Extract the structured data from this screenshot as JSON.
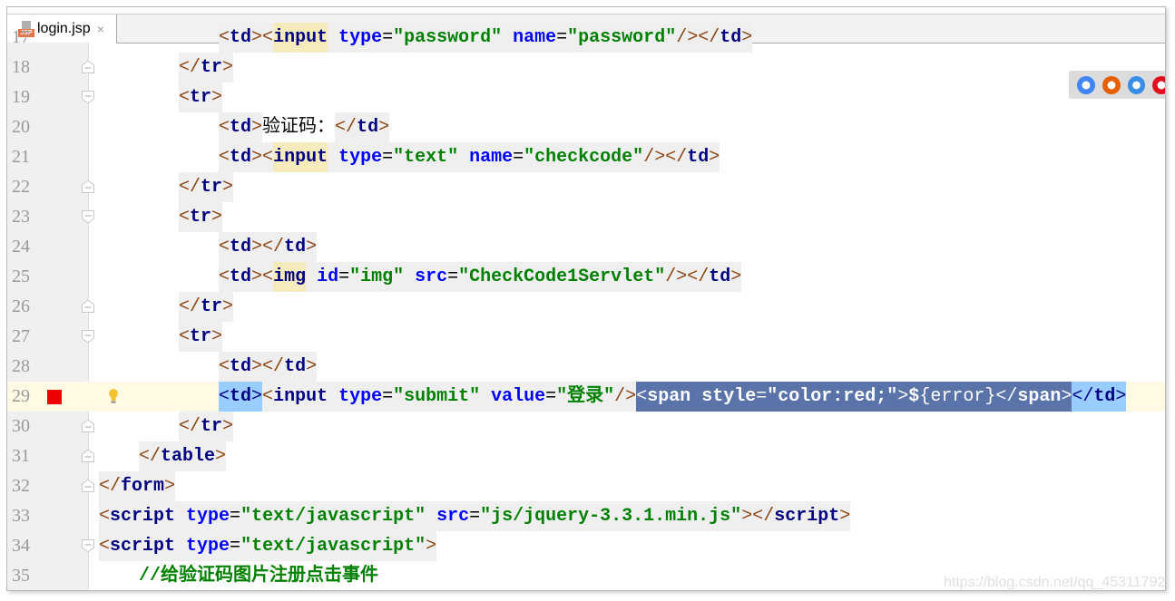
{
  "tab": {
    "file_name": "login.jsp",
    "icon_label": "JSP",
    "close": "×"
  },
  "browsers": [
    {
      "name": "chrome-icon",
      "color": "#4285f4"
    },
    {
      "name": "firefox-icon",
      "color": "#e66000"
    },
    {
      "name": "safari-icon",
      "color": "#3a8ee6"
    },
    {
      "name": "opera-icon",
      "color": "#e0101f"
    }
  ],
  "watermark": "https://blog.csdn.net/qq_45311792",
  "lines": [
    {
      "n": "17",
      "indent": 3,
      "fold": "",
      "tokens": [
        [
          "br",
          "<"
        ],
        [
          "tg",
          "td"
        ],
        [
          "br",
          ">"
        ],
        [
          "br",
          "<"
        ],
        [
          "tgh",
          "input"
        ],
        [
          "at",
          " type"
        ],
        [
          "eq",
          "="
        ],
        [
          "vl",
          "\"password\""
        ],
        [
          "at",
          " name"
        ],
        [
          "eq",
          "="
        ],
        [
          "vl",
          "\"password\""
        ],
        [
          "br",
          "/>"
        ],
        [
          "br",
          "</"
        ],
        [
          "tg",
          "td"
        ],
        [
          "br",
          ">"
        ]
      ]
    },
    {
      "n": "18",
      "indent": 2,
      "fold": "end",
      "tokens": [
        [
          "br",
          "</"
        ],
        [
          "tg",
          "tr"
        ],
        [
          "br",
          ">"
        ]
      ]
    },
    {
      "n": "19",
      "indent": 2,
      "fold": "start",
      "tokens": [
        [
          "br",
          "<"
        ],
        [
          "tg",
          "tr"
        ],
        [
          "br",
          ">"
        ]
      ]
    },
    {
      "n": "20",
      "indent": 3,
      "fold": "",
      "tokens": [
        [
          "br",
          "<"
        ],
        [
          "tg",
          "td"
        ],
        [
          "br",
          ">"
        ],
        [
          "tx",
          "验证码："
        ],
        [
          "br",
          "</"
        ],
        [
          "tg",
          "td"
        ],
        [
          "br",
          ">"
        ]
      ]
    },
    {
      "n": "21",
      "indent": 3,
      "fold": "",
      "tokens": [
        [
          "br",
          "<"
        ],
        [
          "tg",
          "td"
        ],
        [
          "br",
          ">"
        ],
        [
          "br",
          "<"
        ],
        [
          "tgh",
          "input"
        ],
        [
          "at",
          " type"
        ],
        [
          "eq",
          "="
        ],
        [
          "vl",
          "\"text\""
        ],
        [
          "at",
          " name"
        ],
        [
          "eq",
          "="
        ],
        [
          "vl",
          "\"checkcode\""
        ],
        [
          "br",
          "/>"
        ],
        [
          "br",
          "</"
        ],
        [
          "tg",
          "td"
        ],
        [
          "br",
          ">"
        ]
      ]
    },
    {
      "n": "22",
      "indent": 2,
      "fold": "end",
      "tokens": [
        [
          "br",
          "</"
        ],
        [
          "tg",
          "tr"
        ],
        [
          "br",
          ">"
        ]
      ]
    },
    {
      "n": "23",
      "indent": 2,
      "fold": "start",
      "tokens": [
        [
          "br",
          "<"
        ],
        [
          "tg",
          "tr"
        ],
        [
          "br",
          ">"
        ]
      ]
    },
    {
      "n": "24",
      "indent": 3,
      "fold": "",
      "tokens": [
        [
          "br",
          "<"
        ],
        [
          "tg",
          "td"
        ],
        [
          "br",
          ">"
        ],
        [
          "br",
          "</"
        ],
        [
          "tg",
          "td"
        ],
        [
          "br",
          ">"
        ]
      ]
    },
    {
      "n": "25",
      "indent": 3,
      "fold": "",
      "tokens": [
        [
          "br",
          "<"
        ],
        [
          "tg",
          "td"
        ],
        [
          "br",
          ">"
        ],
        [
          "br",
          "<"
        ],
        [
          "tgh",
          "img"
        ],
        [
          "at",
          " id"
        ],
        [
          "eq",
          "="
        ],
        [
          "vl",
          "\"img\""
        ],
        [
          "at",
          " src"
        ],
        [
          "eq",
          "="
        ],
        [
          "vl",
          "\"CheckCode1Servlet\""
        ],
        [
          "br",
          "/>"
        ],
        [
          "br",
          "</"
        ],
        [
          "tg",
          "td"
        ],
        [
          "br",
          ">"
        ]
      ]
    },
    {
      "n": "26",
      "indent": 2,
      "fold": "end",
      "tokens": [
        [
          "br",
          "</"
        ],
        [
          "tg",
          "tr"
        ],
        [
          "br",
          ">"
        ]
      ]
    },
    {
      "n": "27",
      "indent": 2,
      "fold": "start",
      "tokens": [
        [
          "br",
          "<"
        ],
        [
          "tg",
          "tr"
        ],
        [
          "br",
          ">"
        ]
      ]
    },
    {
      "n": "28",
      "indent": 3,
      "fold": "",
      "tokens": [
        [
          "br",
          "<"
        ],
        [
          "tg",
          "td"
        ],
        [
          "br",
          ">"
        ],
        [
          "br",
          "</"
        ],
        [
          "tg",
          "td"
        ],
        [
          "br",
          ">"
        ]
      ]
    },
    {
      "n": "29",
      "indent": 3,
      "fold": "",
      "current": true,
      "breakpoint": true,
      "tokens": [
        [
          "mtb",
          "<"
        ],
        [
          "mt",
          "td"
        ],
        [
          "mtb",
          ">"
        ],
        [
          "br",
          "<"
        ],
        [
          "tg",
          "input"
        ],
        [
          "at",
          " type"
        ],
        [
          "eq",
          "="
        ],
        [
          "vl",
          "\"submit\""
        ],
        [
          "at",
          " value"
        ],
        [
          "eq",
          "="
        ],
        [
          "vl",
          "\"登录\""
        ],
        [
          "br",
          "/>"
        ],
        [
          "sel",
          "<"
        ],
        [
          "selb",
          "span"
        ],
        [
          "selb",
          " style"
        ],
        [
          "sel",
          "="
        ],
        [
          "selb",
          "\"color:red;\""
        ],
        [
          "sel",
          ">"
        ],
        [
          "selb",
          "$"
        ],
        [
          "sel",
          "{error}"
        ],
        [
          "sel",
          "</"
        ],
        [
          "selb",
          "span"
        ],
        [
          "sel",
          ">"
        ],
        [
          "mtb",
          "</"
        ],
        [
          "mt",
          "td"
        ],
        [
          "mtb",
          ">"
        ]
      ]
    },
    {
      "n": "30",
      "indent": 2,
      "fold": "end",
      "tokens": [
        [
          "br",
          "</"
        ],
        [
          "tg",
          "tr"
        ],
        [
          "br",
          ">"
        ]
      ]
    },
    {
      "n": "31",
      "indent": 1,
      "fold": "end",
      "tokens": [
        [
          "br",
          "</"
        ],
        [
          "tg",
          "table"
        ],
        [
          "br",
          ">"
        ]
      ]
    },
    {
      "n": "32",
      "indent": 0,
      "fold": "end",
      "tokens": [
        [
          "br",
          "</"
        ],
        [
          "tg",
          "form"
        ],
        [
          "br",
          ">"
        ]
      ]
    },
    {
      "n": "33",
      "indent": 0,
      "fold": "",
      "tokens": [
        [
          "br",
          "<"
        ],
        [
          "tg",
          "script"
        ],
        [
          "at",
          " type"
        ],
        [
          "eq",
          "="
        ],
        [
          "vl",
          "\"text/javascript\""
        ],
        [
          "at",
          " src"
        ],
        [
          "eq",
          "="
        ],
        [
          "vl",
          "\"js/jquery-3.3.1.min.js\""
        ],
        [
          "br",
          ">"
        ],
        [
          "br",
          "</"
        ],
        [
          "tg",
          "script"
        ],
        [
          "br",
          ">"
        ]
      ]
    },
    {
      "n": "34",
      "indent": 0,
      "fold": "start",
      "tokens": [
        [
          "br",
          "<"
        ],
        [
          "tg",
          "script"
        ],
        [
          "at",
          " type"
        ],
        [
          "eq",
          "="
        ],
        [
          "vl",
          "\"text/javascript\""
        ],
        [
          "br",
          ">"
        ]
      ]
    },
    {
      "n": "35",
      "indent": 1,
      "fold": "",
      "tokens": [
        [
          "cmz",
          "//给验证码图片注册点击事件"
        ]
      ]
    }
  ]
}
